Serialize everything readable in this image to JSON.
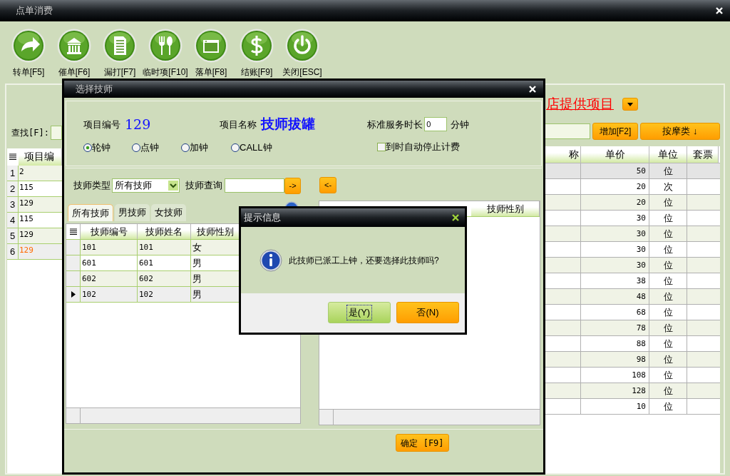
{
  "window": {
    "title": "点单消费"
  },
  "toolbar": [
    {
      "label": "转单[F5]",
      "kind": "arrow"
    },
    {
      "label": "催单[F6]",
      "kind": "building"
    },
    {
      "label": "漏打[F7]",
      "kind": "document"
    },
    {
      "label": "临时项[F10]",
      "kind": "cutlery"
    },
    {
      "label": "落单[F8]",
      "kind": "screen"
    },
    {
      "label": "结账[F9]",
      "kind": "dollar"
    },
    {
      "label": "关闭[ESC]",
      "kind": "power"
    }
  ],
  "catalog": {
    "title": "店提供项目",
    "search_label": "查找[F]:",
    "add_button": "增加[F2]",
    "category_button": "按摩类 ↓",
    "order_table": {
      "columns": [
        "项目编"
      ],
      "rows": [
        {
          "index": "1",
          "code": "2",
          "selected": false
        },
        {
          "index": "2",
          "code": "115",
          "selected": false
        },
        {
          "index": "3",
          "code": "129",
          "selected": false
        },
        {
          "index": "4",
          "code": "115",
          "selected": false
        },
        {
          "index": "5",
          "code": "129",
          "selected": false
        },
        {
          "index": "6",
          "code": "129",
          "selected": true
        }
      ]
    },
    "item_table": {
      "columns": [
        "称",
        "单价",
        "单位",
        "套票"
      ],
      "rows": [
        {
          "price": "50",
          "unit": "位",
          "selected": true
        },
        {
          "price": "20",
          "unit": "次",
          "selected": false
        },
        {
          "price": "20",
          "unit": "位",
          "selected": false
        },
        {
          "price": "30",
          "unit": "位",
          "selected": false
        },
        {
          "price": "30",
          "unit": "位",
          "selected": false
        },
        {
          "price": "30",
          "unit": "位",
          "selected": false
        },
        {
          "price": "30",
          "unit": "位",
          "selected": false
        },
        {
          "price": "38",
          "unit": "位",
          "selected": false
        },
        {
          "price": "48",
          "unit": "位",
          "selected": false
        },
        {
          "price": "68",
          "unit": "位",
          "selected": false
        },
        {
          "price": "78",
          "unit": "位",
          "selected": false
        },
        {
          "price": "88",
          "unit": "位",
          "selected": false
        },
        {
          "price": "98",
          "unit": "位",
          "selected": false
        },
        {
          "price": "108",
          "unit": "位",
          "selected": false
        },
        {
          "price": "128",
          "unit": "位",
          "selected": false
        },
        {
          "price": "10",
          "unit": "位",
          "selected": false
        }
      ]
    }
  },
  "technician_dialog": {
    "title": "选择技师",
    "code_label": "项目编号",
    "code": "129",
    "name_label": "项目名称",
    "name": "技师拔罐",
    "duration_label": "标准服务时长",
    "duration": "0",
    "duration_unit": "分钟",
    "clock_types": [
      {
        "label": "轮钟",
        "selected": true
      },
      {
        "label": "点钟",
        "selected": false
      },
      {
        "label": "加钟",
        "selected": false
      },
      {
        "label": "CALL钟",
        "selected": false
      }
    ],
    "auto_stop": {
      "label": "到时自动停止计费",
      "checked": false
    },
    "type_label": "技师类型",
    "type_value": "所有技师",
    "query_label": "技师查询",
    "add_button": "->",
    "remove_button": "<-",
    "tabs": [
      {
        "label": "所有技师",
        "selected": true
      },
      {
        "label": "男技师",
        "selected": false
      },
      {
        "label": "女技师",
        "selected": false
      }
    ],
    "available": {
      "columns": [
        "技师编号",
        "技师姓名",
        "技师性别"
      ],
      "rows": [
        {
          "code": "101",
          "name": "101",
          "gender": "女",
          "current": false
        },
        {
          "code": "601",
          "name": "601",
          "gender": "男",
          "current": false
        },
        {
          "code": "602",
          "name": "602",
          "gender": "男",
          "current": false
        },
        {
          "code": "102",
          "name": "102",
          "gender": "男",
          "current": true
        }
      ]
    },
    "chosen": {
      "columns": [
        "技师性别"
      ]
    },
    "confirm_button": "确定 [F9]"
  },
  "message_box": {
    "title": "提示信息",
    "text": "此技师已派工上钟，还要选择此技师吗?",
    "buttons": [
      {
        "label": "是(Y)",
        "focused": true
      },
      {
        "label": "否(N)",
        "focused": false
      }
    ]
  }
}
